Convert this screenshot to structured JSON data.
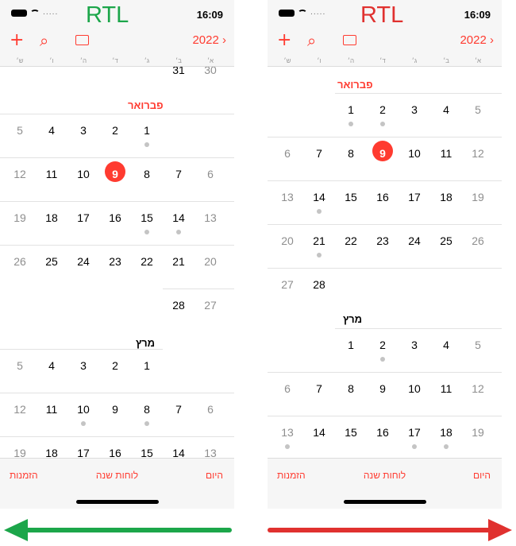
{
  "screens": [
    {
      "heading": "RTL",
      "heading_color": "#1ca64a",
      "status": {
        "time": "16:09",
        "signal_dots": "....."
      },
      "toolbar": {
        "year": "2022",
        "year_chevron": "›"
      },
      "weekdays": [
        "ש׳",
        "ו׳",
        "ה׳",
        "ד׳",
        "ג׳",
        "ב׳",
        "א׳"
      ],
      "feb_label": "פברואר",
      "mar_label": "מרץ",
      "tabs": {
        "today": "היום",
        "year_view": "לוחות שנה",
        "invites": "הזמנות"
      }
    },
    {
      "heading": "RTL",
      "heading_color": "#e0312f",
      "status": {
        "time": "16:09",
        "signal_dots": "....."
      },
      "toolbar": {
        "year": "2022",
        "year_chevron": "›"
      },
      "weekdays": [
        "ש׳",
        "ו׳",
        "ה׳",
        "ד׳",
        "ג׳",
        "ב׳",
        "א׳"
      ],
      "feb_label": "פברואר",
      "mar_label": "מרץ",
      "tabs": {
        "today": "היום",
        "year_view": "לוחות שנה",
        "invites": "הזמנות"
      }
    }
  ],
  "calendars": [
    {
      "jan_tail": [
        {
          "d": "31"
        },
        {
          "d": "30",
          "weekend": true
        }
      ],
      "feb_rows": [
        [
          {
            "d": "5",
            "weekend": true
          },
          {
            "d": "4"
          },
          {
            "d": "3"
          },
          {
            "d": "2"
          },
          {
            "d": "1",
            "event": true
          }
        ],
        [
          {
            "d": "12",
            "weekend": true
          },
          {
            "d": "11"
          },
          {
            "d": "10"
          },
          {
            "d": "9",
            "today": true
          },
          {
            "d": "8"
          },
          {
            "d": "7"
          },
          {
            "d": "6",
            "weekend": true
          }
        ],
        [
          {
            "d": "19",
            "weekend": true
          },
          {
            "d": "18"
          },
          {
            "d": "17"
          },
          {
            "d": "16"
          },
          {
            "d": "15",
            "event": true
          },
          {
            "d": "14",
            "event": true
          },
          {
            "d": "13",
            "weekend": true
          }
        ],
        [
          {
            "d": "26",
            "weekend": true
          },
          {
            "d": "25"
          },
          {
            "d": "24"
          },
          {
            "d": "23"
          },
          {
            "d": "22"
          },
          {
            "d": "21"
          },
          {
            "d": "20",
            "weekend": true
          }
        ],
        [
          {
            "d": "28"
          },
          {
            "d": "27",
            "weekend": true
          }
        ]
      ],
      "mar_rows": [
        [
          {
            "d": "5",
            "weekend": true
          },
          {
            "d": "4"
          },
          {
            "d": "3"
          },
          {
            "d": "2"
          },
          {
            "d": "1"
          }
        ],
        [
          {
            "d": "12",
            "weekend": true
          },
          {
            "d": "11"
          },
          {
            "d": "10",
            "event": true
          },
          {
            "d": "9"
          },
          {
            "d": "8",
            "event": true
          },
          {
            "d": "7"
          },
          {
            "d": "6",
            "weekend": true
          }
        ],
        [
          {
            "d": "19",
            "weekend": true
          },
          {
            "d": "18"
          },
          {
            "d": "17"
          },
          {
            "d": "16"
          },
          {
            "d": "15"
          },
          {
            "d": "14"
          },
          {
            "d": "13",
            "weekend": true
          }
        ]
      ]
    },
    {
      "feb_rows": [
        [
          {
            "d": "1",
            "event": true
          },
          {
            "d": "2",
            "event": true
          },
          {
            "d": "3"
          },
          {
            "d": "4"
          },
          {
            "d": "5",
            "weekend": true
          }
        ],
        [
          {
            "d": "6",
            "weekend": true
          },
          {
            "d": "7"
          },
          {
            "d": "8"
          },
          {
            "d": "9",
            "today": true
          },
          {
            "d": "10"
          },
          {
            "d": "11"
          },
          {
            "d": "12",
            "weekend": true
          }
        ],
        [
          {
            "d": "13",
            "weekend": true
          },
          {
            "d": "14",
            "event": true
          },
          {
            "d": "15"
          },
          {
            "d": "16"
          },
          {
            "d": "17"
          },
          {
            "d": "18"
          },
          {
            "d": "19",
            "weekend": true
          }
        ],
        [
          {
            "d": "20",
            "weekend": true
          },
          {
            "d": "21",
            "event": true
          },
          {
            "d": "22"
          },
          {
            "d": "23"
          },
          {
            "d": "24"
          },
          {
            "d": "25"
          },
          {
            "d": "26",
            "weekend": true
          }
        ],
        [
          {
            "d": "27",
            "weekend": true
          },
          {
            "d": "28"
          }
        ]
      ],
      "mar_rows": [
        [
          {
            "d": "1"
          },
          {
            "d": "2",
            "event": true
          },
          {
            "d": "3"
          },
          {
            "d": "4"
          },
          {
            "d": "5",
            "weekend": true
          }
        ],
        [
          {
            "d": "6",
            "weekend": true
          },
          {
            "d": "7"
          },
          {
            "d": "8"
          },
          {
            "d": "9"
          },
          {
            "d": "10"
          },
          {
            "d": "11"
          },
          {
            "d": "12",
            "weekend": true
          }
        ],
        [
          {
            "d": "13",
            "weekend": true,
            "event": true
          },
          {
            "d": "14"
          },
          {
            "d": "15"
          },
          {
            "d": "16"
          },
          {
            "d": "17",
            "event": true
          },
          {
            "d": "18",
            "event": true
          },
          {
            "d": "19",
            "weekend": true
          }
        ]
      ]
    }
  ],
  "colors": {
    "accent": "#ff3b30",
    "correct_arrow": "#1ca64a",
    "wrong_arrow": "#e0312f",
    "weekend_text": "#8e8e8e",
    "event_dot": "#c4c4c4"
  }
}
